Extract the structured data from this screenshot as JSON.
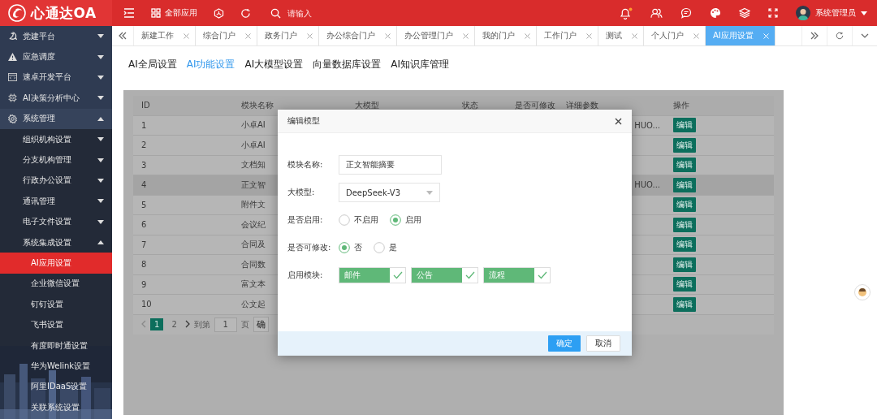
{
  "topbar": {
    "logo": "心通达OA",
    "apps_label": "全部应用",
    "search": {
      "placeholder": "请输入"
    },
    "unread": true,
    "user": "系统管理员"
  },
  "sidebar": {
    "items": [
      {
        "label": "党建平台",
        "expanded": false
      },
      {
        "label": "应急调度",
        "expanded": false
      },
      {
        "label": "速卓开发平台",
        "expanded": false
      },
      {
        "label": "AI决策分析中心",
        "expanded": false
      },
      {
        "label": "系统管理",
        "expanded": true,
        "children": [
          {
            "label": "组织机构设置",
            "expanded": false
          },
          {
            "label": "分支机构管理",
            "expanded": false
          },
          {
            "label": "行政办公设置",
            "expanded": false
          },
          {
            "label": "通讯管理",
            "expanded": false
          },
          {
            "label": "电子文件设置",
            "expanded": false
          },
          {
            "label": "系统集成设置",
            "expanded": true,
            "children": [
              {
                "label": "AI应用设置",
                "selected": true
              },
              {
                "label": "企业微信设置",
                "selected": false
              },
              {
                "label": "钉钉设置",
                "selected": false
              },
              {
                "label": "飞书设置",
                "selected": false
              },
              {
                "label": "有度即时通设置",
                "selected": false
              },
              {
                "label": "华为Welink设置",
                "selected": false
              },
              {
                "label": "阿里IDaaS设置",
                "selected": false
              },
              {
                "label": "关联系统设置",
                "selected": false
              }
            ]
          }
        ]
      }
    ]
  },
  "tabs": [
    {
      "label": "新建工作",
      "selected": false
    },
    {
      "label": "综合门户",
      "selected": false
    },
    {
      "label": "政务门户",
      "selected": false
    },
    {
      "label": "办公综合门户",
      "selected": false
    },
    {
      "label": "办公管理门户",
      "selected": false
    },
    {
      "label": "我的门户",
      "selected": false
    },
    {
      "label": "工作门户",
      "selected": false
    },
    {
      "label": "测试",
      "selected": false
    },
    {
      "label": "个人门户",
      "selected": false
    },
    {
      "label": "AI应用设置",
      "selected": true
    }
  ],
  "subtabs": [
    {
      "label": "AI全局设置",
      "selected": false
    },
    {
      "label": "AI功能设置",
      "selected": true
    },
    {
      "label": "AI大模型设置",
      "selected": false
    },
    {
      "label": "向量数据库设置",
      "selected": false
    },
    {
      "label": "AI知识库管理",
      "selected": false
    }
  ],
  "table": {
    "columns": [
      "ID",
      "模块名称",
      "大模型",
      "状态",
      "是否可修改",
      "详细参数",
      "操作"
    ],
    "rows": [
      {
        "id": "1",
        "name": "小卓AI",
        "detail": "HUO...",
        "action": "编辑",
        "highlighted": false
      },
      {
        "id": "2",
        "name": "小卓AI",
        "action": "编辑",
        "highlighted": false
      },
      {
        "id": "3",
        "name": "文档知",
        "action": "编辑",
        "highlighted": false
      },
      {
        "id": "4",
        "name": "正文智",
        "detail": "HUO...",
        "action": "编辑",
        "highlighted": true
      },
      {
        "id": "5",
        "name": "附件文",
        "action": "编辑",
        "highlighted": false
      },
      {
        "id": "6",
        "name": "会议纪",
        "action": "编辑",
        "highlighted": false
      },
      {
        "id": "7",
        "name": "合同及",
        "action": "编辑",
        "highlighted": false
      },
      {
        "id": "8",
        "name": "合同数",
        "action": "编辑",
        "highlighted": false
      },
      {
        "id": "9",
        "name": "富文本",
        "action": "编辑",
        "highlighted": false
      },
      {
        "id": "10",
        "name": "公文起",
        "action": "编辑",
        "highlighted": false
      }
    ],
    "pagination": {
      "pages": [
        {
          "label": "1",
          "selected": true
        },
        {
          "label": "2",
          "selected": false
        }
      ],
      "goto_label": "到第",
      "page_input": "1",
      "page_unit": "页",
      "go_button": "确"
    }
  },
  "modal": {
    "title": "编辑模型",
    "fields": [
      {
        "kind": "text",
        "label": "模块名称:",
        "value": "正文智能摘要"
      },
      {
        "kind": "select",
        "label": "大模型:",
        "value": "DeepSeek-V3"
      },
      {
        "kind": "radio",
        "label": "是否启用:",
        "options": [
          {
            "label": "不启用",
            "selected": false
          },
          {
            "label": "启用",
            "selected": true
          }
        ]
      },
      {
        "kind": "radio",
        "label": "是否可修改:",
        "options": [
          {
            "label": "否",
            "selected": true
          },
          {
            "label": "是",
            "selected": false
          }
        ]
      },
      {
        "kind": "tags",
        "label": "启用模块:",
        "options": [
          {
            "label": "邮件",
            "checked": true
          },
          {
            "label": "公告",
            "checked": true
          },
          {
            "label": "流程",
            "checked": true
          }
        ]
      }
    ],
    "buttons": [
      {
        "label": "确定",
        "kind": "primary"
      },
      {
        "label": "取消",
        "kind": "default"
      }
    ]
  }
}
